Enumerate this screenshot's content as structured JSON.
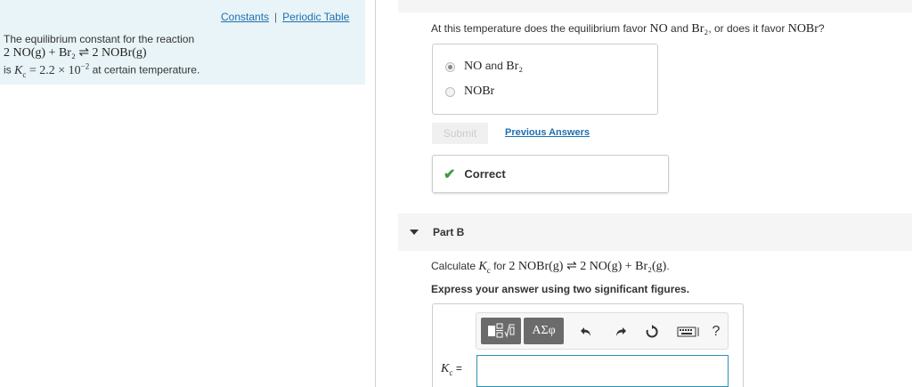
{
  "links": {
    "constants": "Constants",
    "separator": "|",
    "periodic_table": "Periodic Table"
  },
  "problem": {
    "intro": "The equilibrium constant for the reaction",
    "equation": "2 NO(g) + Br₂ ⇌ 2 NOBr(g)",
    "is": "is",
    "kc_symbol": "K",
    "kc_sub": "c",
    "kc_value": "= 2.2 × 10",
    "kc_exp": "−2",
    "tail": "at certain temperature."
  },
  "partA": {
    "q_pre": "At this temperature does the equilibrium favor",
    "q_sp1": "NO",
    "q_and": "and",
    "q_sp2": "Br₂",
    "q_mid": ", or does it favor",
    "q_sp3": "NOBr",
    "q_end": "?",
    "choice1_a": "NO",
    "choice1_and": "and",
    "choice1_b": "Br₂",
    "choice2": "NOBr",
    "submit": "Submit",
    "previous_answers": "Previous Answers",
    "feedback": "Correct"
  },
  "partB": {
    "title": "Part B",
    "calc_pre": "Calculate",
    "kc_symbol": "K",
    "kc_sub": "c",
    "calc_for": "for",
    "calc_eq": "2 NOBr(g) ⇌ 2 NO(g) + Br₂(g)",
    "calc_end": ".",
    "express": "Express your answer using two significant figures.",
    "greek": "ΑΣφ",
    "help": "?",
    "answer_label_eq": "="
  },
  "colors": {
    "panel_bg": "#e8f4f7",
    "link": "#1e6fb0",
    "correct": "#3c9d3c",
    "input_border": "#2e8fb8"
  },
  "icons": [
    "templates-icon",
    "undo-icon",
    "redo-icon",
    "reset-icon",
    "keyboard-icon",
    "help-icon",
    "checkmark-icon",
    "caret-down-icon"
  ]
}
